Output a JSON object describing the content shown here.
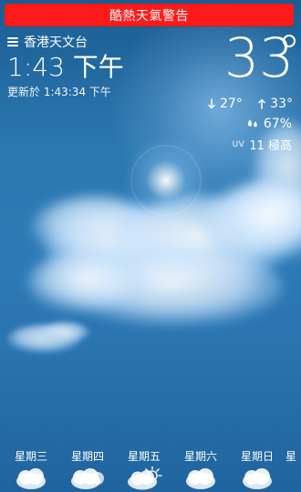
{
  "warning": {
    "label": "酷熱天氣警告"
  },
  "header": {
    "station": "香港天文台",
    "time": "1:43 下午",
    "updated": "更新於 1:43:34 下午"
  },
  "current": {
    "temperature": "33",
    "min": "27°",
    "max": "33°",
    "humidity": "67%",
    "uv_label": "UV",
    "uv": "11 極高"
  },
  "forecast": [
    {
      "day": "星期三",
      "icon": "rain-cloud-icon"
    },
    {
      "day": "星期四",
      "icon": "rain-cloud-icon"
    },
    {
      "day": "星期五",
      "icon": "sun-rain-cloud-icon"
    },
    {
      "day": "星期六",
      "icon": "rain-cloud-icon"
    },
    {
      "day": "星期日",
      "icon": "rain-cloud-icon"
    },
    {
      "day": "星",
      "icon": "rain-cloud-icon"
    }
  ],
  "colors": {
    "warning_red": "#ff1a1a",
    "sky_dark": "#1a5d92",
    "sky_mid": "#2d7ab6"
  }
}
